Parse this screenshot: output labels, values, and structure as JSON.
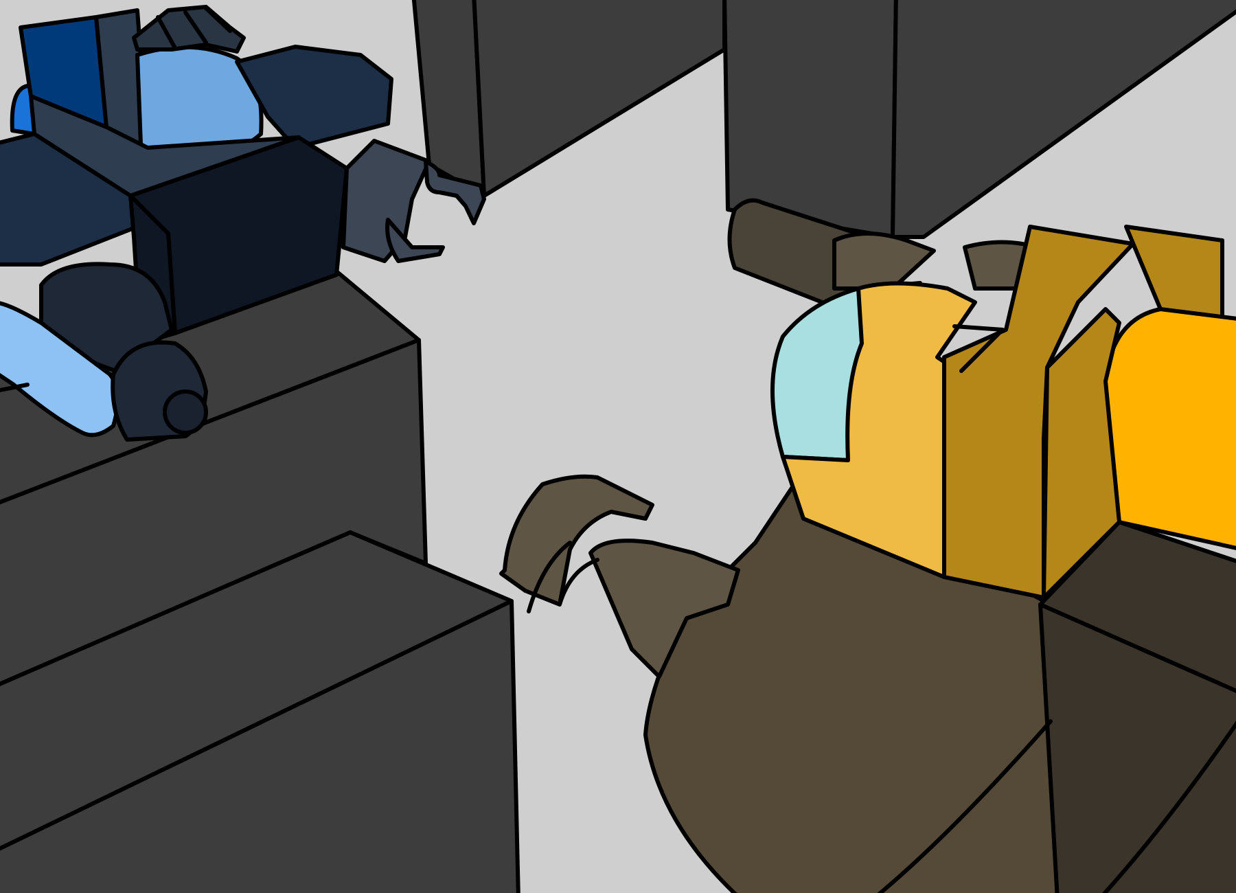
{
  "scene": {
    "description_visible_text": "",
    "palette": {
      "floor": "#cfcfcf",
      "crate": "#3d3d3d",
      "blue_robot_light": "#6fa8e0",
      "blue_robot_dark": "#1c2f47",
      "blue_robot_deep": "#0f1724",
      "blue_robot_accent": "#003a7a",
      "yellow_robot_light": "#f0bb44",
      "yellow_robot_mid": "#b58618",
      "yellow_robot_bright": "#ffb300",
      "yellow_robot_body": "#544a37",
      "visor": "#a9dfe0"
    }
  }
}
